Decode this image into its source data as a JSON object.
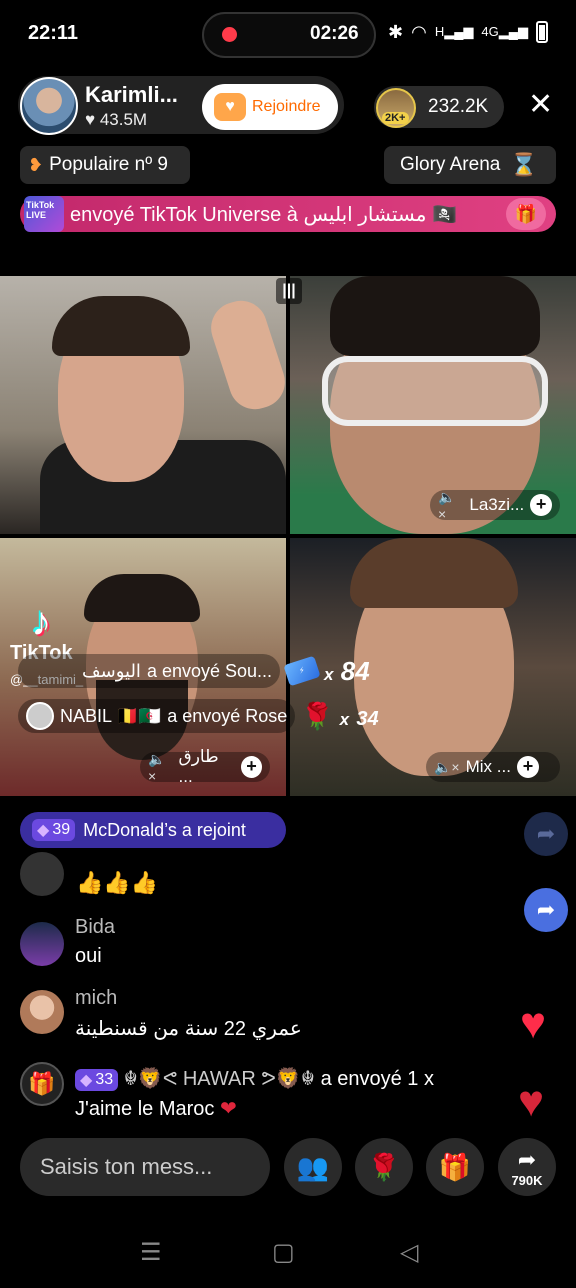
{
  "status_bar": {
    "time": "22:11",
    "recording_time": "02:26",
    "icons": [
      "bluetooth-icon",
      "wifi-icon",
      "signal-icon",
      "4g-icon",
      "battery-icon"
    ],
    "wifi_label": "H",
    "network_label": "4G"
  },
  "host": {
    "name": "Karimli...",
    "likes": "43.5M",
    "join_label": "Rejoindre"
  },
  "viewers": {
    "badge": "2K+",
    "count": "232.2K"
  },
  "rank_chip": {
    "label": "Populaire nº 9"
  },
  "arena_chip": {
    "label": "Glory Arena"
  },
  "gift_banner": {
    "logo_text": "TikTok LIVE",
    "text": "envoyé TikTok Universe à مستشار ابليس 🏴‍☠️"
  },
  "video_tiles": {
    "tile2_label": "La3zi...",
    "tile3_label": "طارق ...",
    "tile4_label": "Mix  ..."
  },
  "watermark": {
    "brand": "TikTok",
    "handle": "@__tamimi_"
  },
  "gift_events": [
    {
      "sender": "اليوسف",
      "action": "a envoyé  Sou...",
      "multiplier": "84"
    },
    {
      "sender": "NABIL 🇧🇪🇩🇿",
      "action": "a envoyé  Rose",
      "multiplier": "34"
    }
  ],
  "chat": {
    "joined": {
      "level": "39",
      "text": "McDonald’s a rejoint"
    },
    "messages": [
      {
        "name": "",
        "text": "👍👍👍"
      },
      {
        "name": "Bida",
        "text": "oui"
      },
      {
        "name": "mich",
        "text": "عمري 22 سنة من قسنطينة"
      }
    ],
    "gift_message": {
      "level": "33",
      "sender": "☬🦁ᕙ HAWAR ᕗ🦁☬",
      "text": "a envoyé 1 x",
      "gift": "J'aime le Maroc"
    }
  },
  "bottom_bar": {
    "input_placeholder": "Saisis ton mess...",
    "share_count": "790K"
  },
  "colors": {
    "accent_pink": "#e04182",
    "join_orange": "#ff6a00",
    "chat_join_bg": "#3a2ea0",
    "heart_red": "#ff2d4a"
  }
}
